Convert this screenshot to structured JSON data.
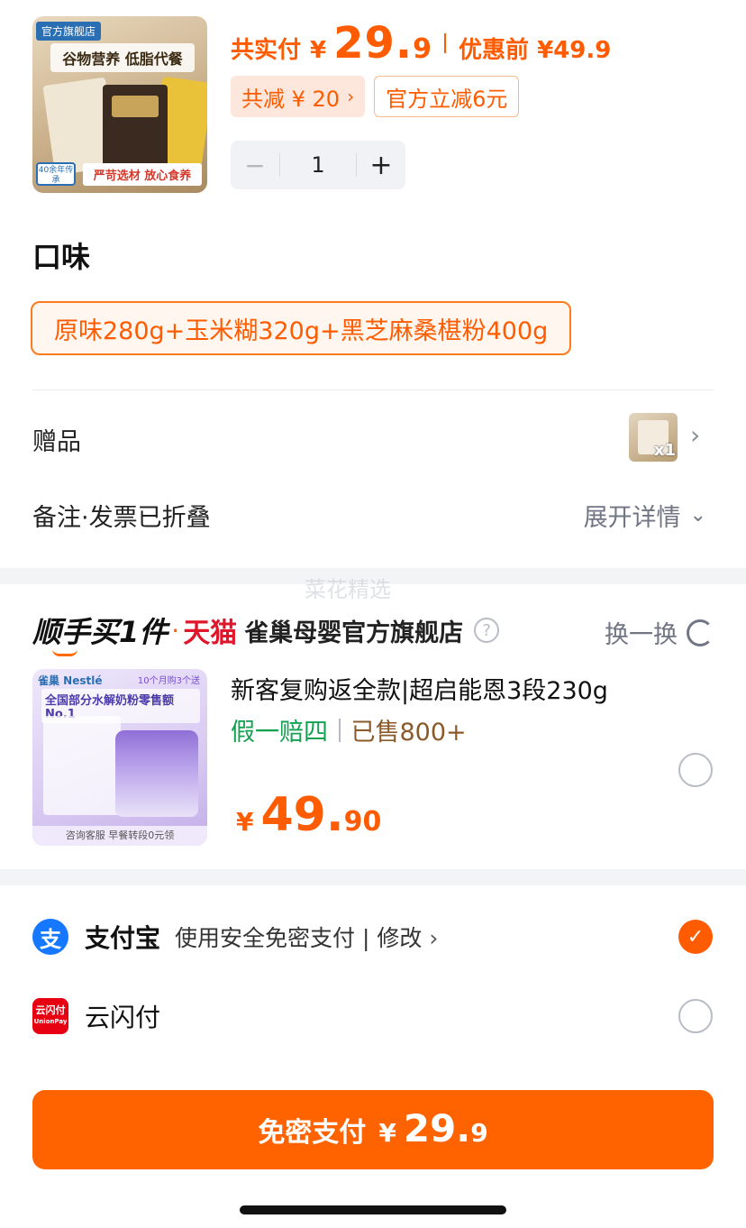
{
  "product": {
    "image": {
      "tag": "官方旗舰店",
      "headline": "谷物营养 低脂代餐",
      "badge": "40余年传承",
      "slogan": "严苛选材 放心食养"
    },
    "paid_label": "共实付",
    "currency": "¥",
    "price_int": "29.",
    "price_dec": "9",
    "original_label": "优惠前 ¥49.9",
    "discount_total": "共减 ¥ 20",
    "discount_official": "官方立减6元",
    "quantity": "1",
    "minus": "−",
    "plus": "+"
  },
  "flavor": {
    "title": "口味",
    "selected": "原味280g+玉米糊320g+黑芝麻桑椹粉400g"
  },
  "gift": {
    "label": "赠品",
    "count": "x1"
  },
  "notes": {
    "label": "备注·发票已折叠",
    "expand": "展开详情"
  },
  "watermark": "菜花精选",
  "recommend": {
    "brand": "顺手买1件",
    "dot": "·",
    "platform": "天猫",
    "shop": "雀巢母婴官方旗舰店",
    "swap": "换一换",
    "image": {
      "brand": "雀巢 Nestlé",
      "promo": "10个月购3个送",
      "title": "全国部分水解奶粉零售额No.1",
      "footer": "咨询客服 早餐转段0元领"
    },
    "name": "新客复购返全款|超启能恩3段230g",
    "tag_guarantee": "假一赔四",
    "tag_sold": "已售800+",
    "currency": "¥",
    "price_int": "49.",
    "price_dec": "90"
  },
  "payment": {
    "alipay": {
      "icon": "支",
      "name": "支付宝",
      "desc": "使用安全免密支付 | 修改",
      "checked": true
    },
    "unionpay": {
      "icon_top": "云闪付",
      "icon_bottom": "UnionPay",
      "name": "云闪付",
      "checked": false
    }
  },
  "pay_button": {
    "label": "免密支付",
    "currency": "¥",
    "price_int": "29.",
    "price_dec": "9"
  },
  "colors": {
    "accent": "#ff5b00",
    "tmall": "#e0162b",
    "guarantee": "#12a150",
    "alipay": "#1677ff"
  }
}
